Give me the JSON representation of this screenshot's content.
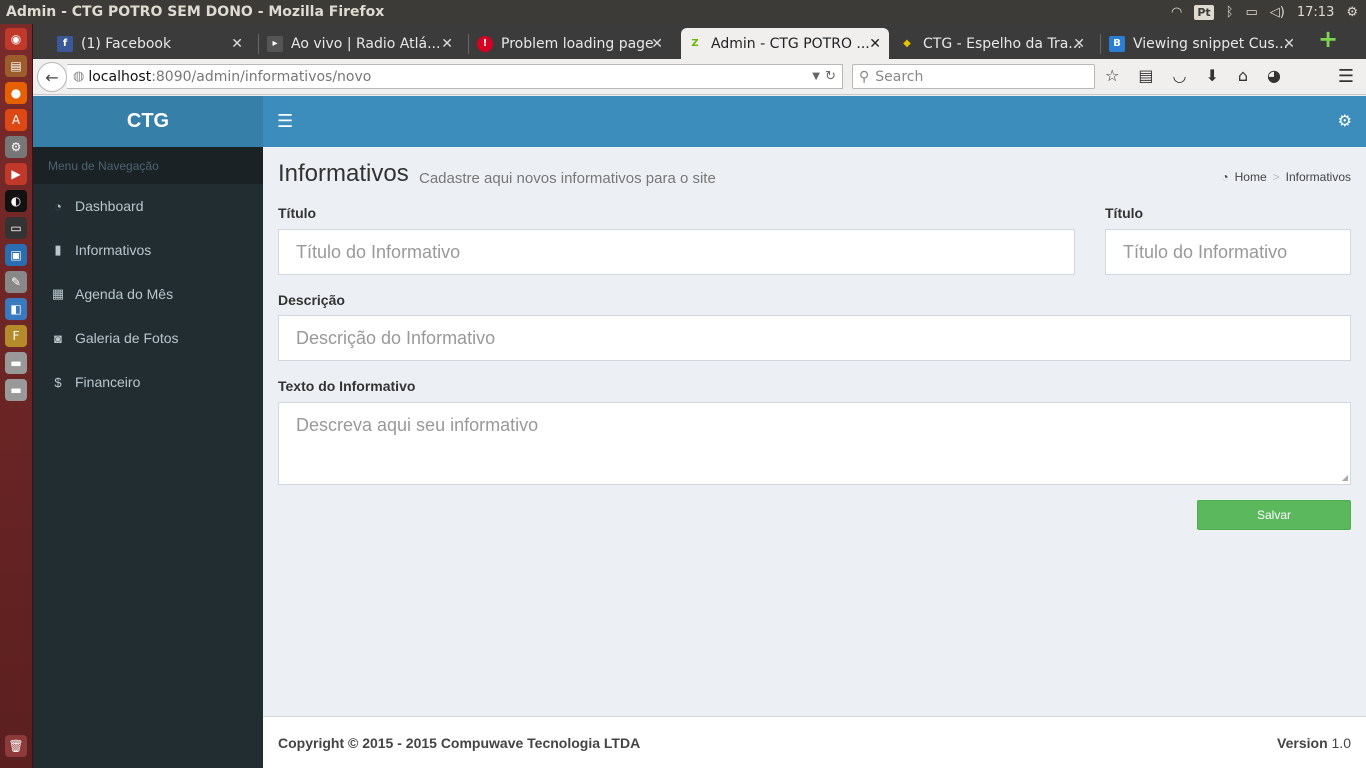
{
  "os": {
    "window_title": "Admin - CTG POTRO SEM DONO - Mozilla Firefox",
    "lang": "Pt",
    "clock": "17:13"
  },
  "tabs": [
    {
      "label": "(1) Facebook",
      "icon": "facebook-icon",
      "color": "#3b5998",
      "glyph": "f"
    },
    {
      "label": "Ao vivo | Radio Atlá...",
      "icon": "radio-icon",
      "color": "#555555",
      "glyph": "▸"
    },
    {
      "label": "Problem loading page",
      "icon": "warning-icon",
      "color": "#d70022",
      "glyph": "!"
    },
    {
      "label": "Admin - CTG POTRO ...",
      "icon": "zend-icon",
      "color": "#68b604",
      "glyph": "Z"
    },
    {
      "label": "CTG - Espelho da Tra...",
      "icon": "shield-icon",
      "color": "#e6c200",
      "glyph": "◆"
    },
    {
      "label": "Viewing snippet Cus...",
      "icon": "bootstrap-icon",
      "color": "#2a7fd4",
      "glyph": "B"
    }
  ],
  "browser": {
    "url_host": "localhost",
    "url_path": ":8090/admin/informativos/novo",
    "search_placeholder": "Search"
  },
  "app": {
    "logo": "CTG",
    "menu_header": "Menu de Navegação",
    "menu": [
      {
        "label": "Dashboard",
        "icon": "dashboard-icon",
        "glyph": "◔"
      },
      {
        "label": "Informativos",
        "icon": "bookmark-icon",
        "glyph": "▮"
      },
      {
        "label": "Agenda do Mês",
        "icon": "calendar-icon",
        "glyph": "▦"
      },
      {
        "label": "Galeria de Fotos",
        "icon": "camera-icon",
        "glyph": "◙"
      },
      {
        "label": "Financeiro",
        "icon": "dollar-icon",
        "glyph": "$"
      }
    ]
  },
  "page": {
    "title": "Informativos",
    "subtitle": "Cadastre aqui novos informativos para o site",
    "breadcrumb_home": "Home",
    "breadcrumb_current": "Informativos"
  },
  "form": {
    "titulo_label": "Título",
    "titulo_placeholder": "Título do Informativo",
    "titulo2_label": "Título",
    "titulo2_placeholder": "Título do Informativo",
    "descricao_label": "Descrição",
    "descricao_placeholder": "Descrição do Informativo",
    "texto_label": "Texto do Informativo",
    "texto_placeholder": "Descreva aqui seu informativo",
    "save_label": "Salvar"
  },
  "footer": {
    "copyright": "Copyright © 2015 - 2015 Compuwave Tecnologia LTDA",
    "version_label": "Version",
    "version_value": "1.0"
  }
}
